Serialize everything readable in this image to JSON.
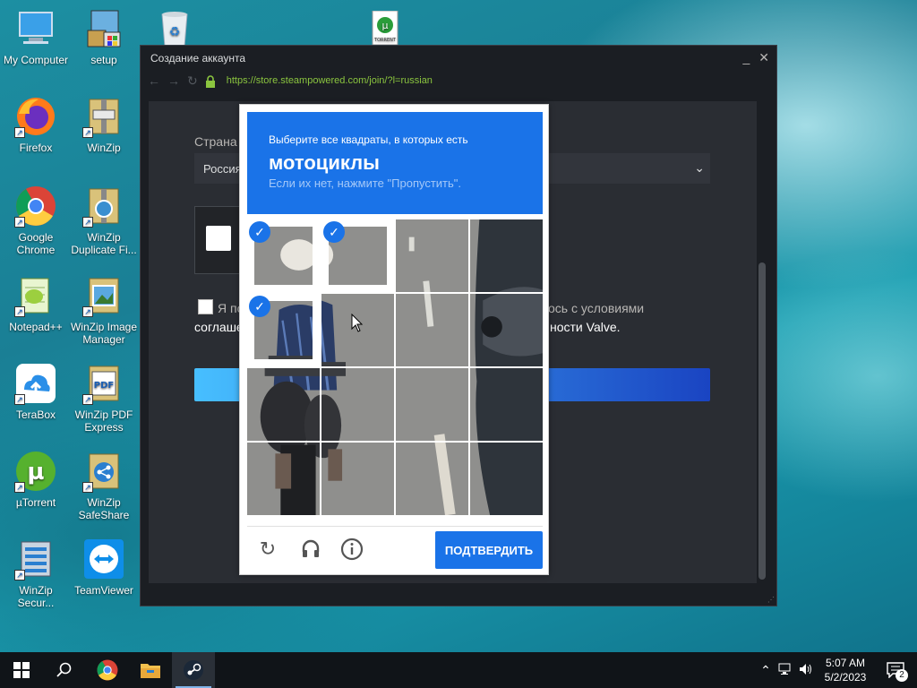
{
  "desktop": {
    "icons": [
      {
        "label": "My Computer",
        "icon": "computer-icon"
      },
      {
        "label": "setup",
        "icon": "setup-icon"
      },
      {
        "label": "Firefox",
        "icon": "firefox-icon"
      },
      {
        "label": "WinZip",
        "icon": "winzip-icon"
      },
      {
        "label": "Google Chrome",
        "icon": "chrome-icon"
      },
      {
        "label": "WinZip Duplicate Fi...",
        "icon": "winzip-duplicate-icon"
      },
      {
        "label": "Notepad++",
        "icon": "notepadpp-icon"
      },
      {
        "label": "WinZip Image Manager",
        "icon": "winzip-image-icon"
      },
      {
        "label": "TeraBox",
        "icon": "terabox-icon"
      },
      {
        "label": "WinZip PDF Express",
        "icon": "winzip-pdf-icon"
      },
      {
        "label": "µTorrent",
        "icon": "utorrent-icon"
      },
      {
        "label": "WinZip SafeShare",
        "icon": "winzip-safeshare-icon"
      },
      {
        "label": "WinZip Secur...",
        "icon": "winzip-secure-icon"
      },
      {
        "label": "TeamViewer",
        "icon": "teamviewer-icon"
      }
    ]
  },
  "window": {
    "title": "Создание аккаунта",
    "url": "https://store.steampowered.com/join/?l=russian",
    "country_label": "Страна",
    "country_value": "Россия",
    "agree_prefix": "Я по",
    "agree_suffix": "ось с условиями",
    "agree_line2_left": "соглаше",
    "agree_line2_right": "ности Valve."
  },
  "captcha": {
    "line1": "Выберите все квадраты, в которых есть",
    "line2": "мотоциклы",
    "line3": "Если их нет, нажмите \"Пропустить\".",
    "verify_label": "ПОДТВЕРДИТЬ",
    "selected_tiles": [
      0,
      1,
      4
    ]
  },
  "taskbar": {
    "time": "5:07 AM",
    "date": "5/2/2023",
    "notification_count": "2"
  }
}
